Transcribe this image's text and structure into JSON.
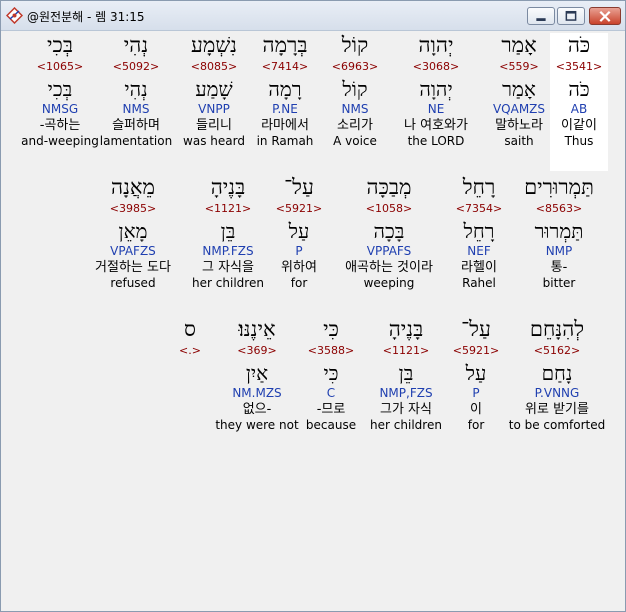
{
  "window": {
    "title": "@원전분해 - 렘 31:15"
  },
  "rows": [
    {
      "words": [
        {
          "heb": "כֹּה",
          "strong": "<3541>",
          "lemma": "כֹּה",
          "parse": "AB",
          "kor": "이같이",
          "eng": "Thus",
          "selected": true
        },
        {
          "heb": "אָמַר",
          "strong": "<559>",
          "lemma": "אָמַר",
          "parse": "VQAMZS",
          "kor": "말하노라",
          "eng": "saith",
          "selected": false
        },
        {
          "heb": "יְהוָה",
          "strong": "<3068>",
          "lemma": "יְהוָה",
          "parse": "NE",
          "kor": "나 여호와가",
          "eng": "the LORD",
          "selected": false
        },
        {
          "heb": "קוֹל",
          "strong": "<6963>",
          "lemma": "קוֹל",
          "parse": "NMS",
          "kor": "소리가",
          "eng": "A voice",
          "selected": false
        },
        {
          "heb": "בְּרָמָה",
          "strong": "<7414>",
          "lemma": "רָמָה",
          "parse": "P.NE",
          "kor": "라마에서",
          "eng": "in Ramah",
          "selected": false
        },
        {
          "heb": "נִשְׁמָע",
          "strong": "<8085>",
          "lemma": "שָׁמַע",
          "parse": "VNPP",
          "kor": "들리니",
          "eng": "was heard",
          "selected": false
        },
        {
          "heb": "נְהִי",
          "strong": "<5092>",
          "lemma": "נְהִי",
          "parse": "NMS",
          "kor": "슬퍼하며",
          "eng": "lamentation",
          "selected": false
        },
        {
          "heb": "בְּכִי",
          "strong": "<1065>",
          "lemma": "בְּכִי",
          "parse": "NMSG",
          "kor": "-곡하는",
          "eng": "and-weeping",
          "selected": false
        }
      ]
    },
    {
      "words": [
        {
          "heb": "תַּמְרוּרִים",
          "strong": "<8563>",
          "lemma": "תַּמְרוּר",
          "parse": "NMP",
          "kor": "통-",
          "eng": "bitter",
          "selected": false
        },
        {
          "heb": "רָחֵל",
          "strong": "<7354>",
          "lemma": "רָחֵל",
          "parse": "NEF",
          "kor": "라헬이",
          "eng": "Rahel",
          "selected": false
        },
        {
          "heb": "מְבַכָּה",
          "strong": "<1058>",
          "lemma": "בָּכָה",
          "parse": "VPPAFS",
          "kor": "애곡하는 것이라",
          "eng": "weeping",
          "selected": false
        },
        {
          "heb": "עַל־",
          "strong": "<5921>",
          "lemma": "עַל",
          "parse": "P",
          "kor": "위하여",
          "eng": "for",
          "selected": false
        },
        {
          "heb": "בָּנֶיהָ",
          "strong": "<1121>",
          "lemma": "בֵּן",
          "parse": "NMP.FZS",
          "kor": "그 자식을",
          "eng": "her children",
          "selected": false
        },
        {
          "heb": "מֵאֲנָה",
          "strong": "<3985>",
          "lemma": "מָאֵן",
          "parse": "VPAFZS",
          "kor": "거절하는 도다",
          "eng": "refused",
          "selected": false
        }
      ]
    },
    {
      "words": [
        {
          "heb": "לְהִנָּחֵם",
          "strong": "<5162>",
          "lemma": "נָחַם",
          "parse": "P.VNNG",
          "kor": "위로 받기를",
          "eng": "to be comforted",
          "selected": false
        },
        {
          "heb": "עַל־",
          "strong": "<5921>",
          "lemma": "עַל",
          "parse": "P",
          "kor": "이",
          "eng": "for",
          "selected": false
        },
        {
          "heb": "בָּנֶיהָ",
          "strong": "<1121>",
          "lemma": "בֵּן",
          "parse": "NMP,FZS",
          "kor": "그가 자식",
          "eng": "her children",
          "selected": false
        },
        {
          "heb": "כִּי",
          "strong": "<3588>",
          "lemma": "כִּי",
          "parse": "C",
          "kor": "-므로",
          "eng": "because",
          "selected": false
        },
        {
          "heb": "אֵינֶנּוּ׃",
          "strong": "<369>",
          "lemma": "אַיִן",
          "parse": "NM.MZS",
          "kor": "없으-",
          "eng": "they were not",
          "selected": false
        },
        {
          "heb": "ס",
          "strong": "<.>",
          "lemma": "",
          "parse": "",
          "kor": "",
          "eng": "",
          "selected": false
        }
      ]
    }
  ]
}
